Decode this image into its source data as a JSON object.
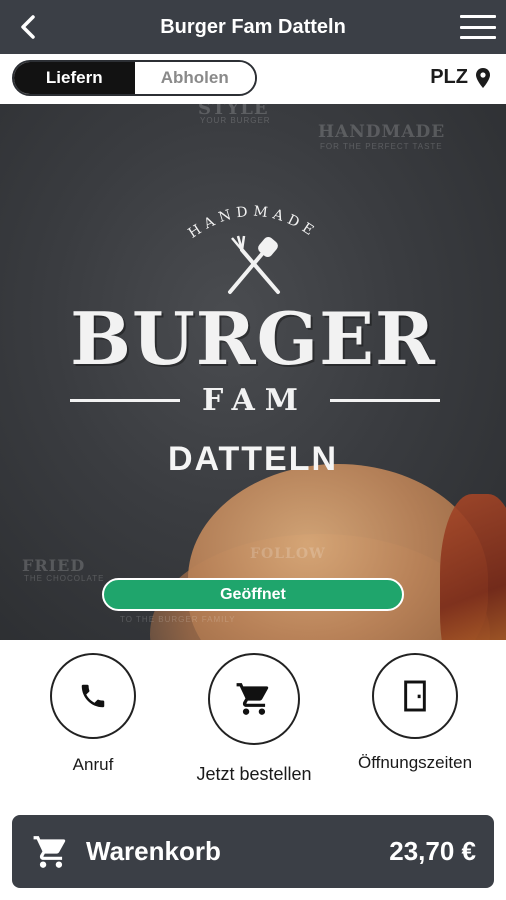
{
  "header": {
    "title": "Burger Fam Datteln",
    "back_icon": "chevron-left-icon",
    "menu_icon": "hamburger-menu-icon"
  },
  "mode": {
    "options": [
      "Liefern",
      "Abholen"
    ],
    "selected": "Liefern",
    "plz_label": "PLZ",
    "plz_icon": "location-pin-icon"
  },
  "hero": {
    "logo_arc": "HANDMADE",
    "logo_title": "BURGER",
    "logo_subtitle": "FAM",
    "city": "DATTELN",
    "background_texts": {
      "style": "STYLE",
      "your_burger": "YOUR BURGER",
      "handmade": "HANDMADE",
      "perfect_taste": "FOR THE PERFECT TASTE",
      "fried": "FRIED",
      "chocolate": "THE CHOCOLATE",
      "follow": "FOLLOW",
      "burger_family": "TO THE BURGER FAMILY"
    },
    "status": "Geöffnet",
    "status_color": "#1fa56c"
  },
  "actions": [
    {
      "label": "Anruf",
      "icon": "phone-icon"
    },
    {
      "label": "Jetzt bestellen",
      "icon": "shopping-cart-icon"
    },
    {
      "label": "Öffnungszeiten",
      "icon": "door-icon"
    }
  ],
  "cart": {
    "label": "Warenkorb",
    "total": "23,70 €",
    "icon": "shopping-cart-icon"
  },
  "colors": {
    "header_bg": "#3b3f46",
    "accent_open": "#1fa56c",
    "segment_active": "#121212"
  }
}
